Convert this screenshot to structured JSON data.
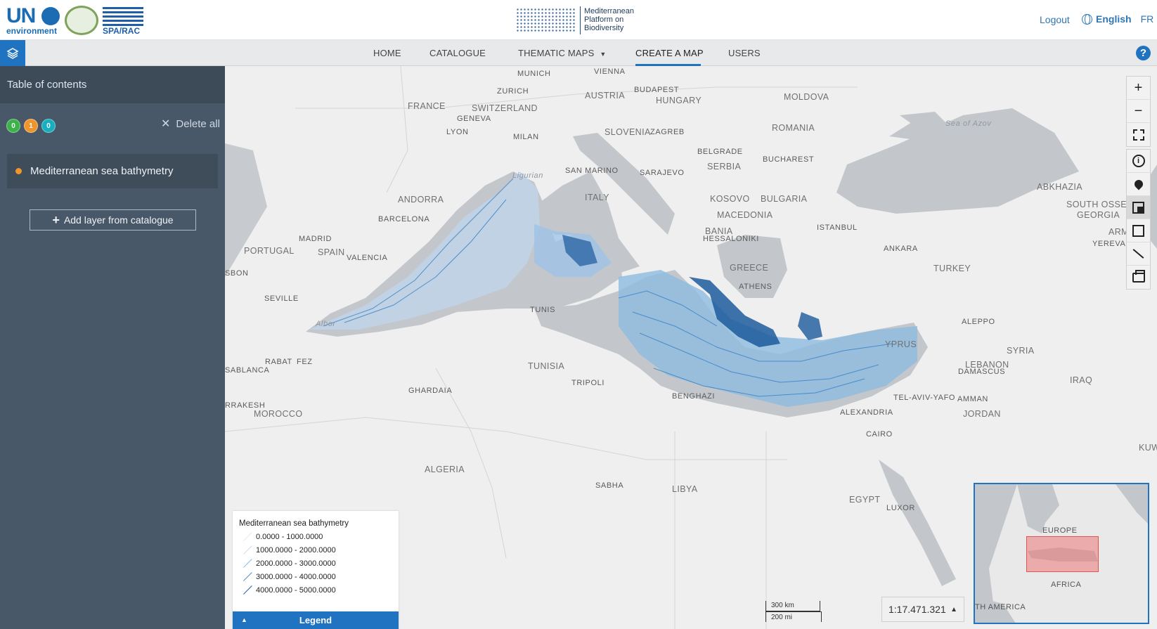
{
  "header": {
    "logo_un": "UN",
    "logo_un_sub": "environment",
    "logo_spa": "SPA/RAC",
    "brand_lines": [
      "Mediterranean",
      "Platform on",
      "Biodiversity"
    ],
    "logout": "Logout",
    "lang_active": "English",
    "lang_other": "FR"
  },
  "nav": {
    "home": "HOME",
    "catalogue": "CATALOGUE",
    "thematic": "THEMATIC MAPS",
    "create": "CREATE A MAP",
    "users": "USERS",
    "help": "?"
  },
  "sidebar": {
    "title": "Table of contents",
    "badges": [
      "0",
      "1",
      "0"
    ],
    "delete_all": "Delete all",
    "layer": "Mediterranean sea bathymetry",
    "add_layer": "Add layer from catalogue"
  },
  "map": {
    "labels": {
      "munich": "MUNICH",
      "vienna": "VIENNA",
      "zurich": "ZURICH",
      "austria": "AUSTRIA",
      "budapest": "BUDAPEST",
      "hungary": "HUNGARY",
      "moldova": "MOLDOVA",
      "france": "FRANCE",
      "switzerland": "SWITZERLAND",
      "geneva": "GENEVA",
      "lyon": "LYON",
      "milan": "MILAN",
      "slovenia": "SLOVENIA",
      "zagreb": "ZAGREB",
      "romania": "ROMANIA",
      "azov": "Sea of Azov",
      "belgrade": "BELGRADE",
      "bucharest": "BUCHAREST",
      "serbia": "SERBIA",
      "sanmarino": "SAN MARINO",
      "sarajevo": "SARAJEVO",
      "andorra": "ANDORRA",
      "italy": "ITALY",
      "kosovo": "KOSOVO",
      "bulgaria": "BULGARIA",
      "abkhazia": "ABKHAZIA",
      "southossetia": "SOUTH OSSETI",
      "georgia": "GEORGIA",
      "barcelona": "BARCELONA",
      "macedonia": "MACEDONIA",
      "istanbul": "ISTANBUL",
      "armenia": "ARMENIA",
      "madrid": "MADRID",
      "portugal": "PORTUGAL",
      "spain": "SPAIN",
      "bania": "BANIA",
      "thessaloniki": "HESSALONIKI",
      "ankara": "ANKARA",
      "yerevan": "YEREVAN",
      "valencia": "VALENCIA",
      "greece": "GREECE",
      "turkey": "TURKEY",
      "lisbon": "SBON",
      "athens": "ATHENS",
      "seville": "SEVILLE",
      "tunis": "TUNIS",
      "aleppo": "ALEPPO",
      "syria": "SYRIA",
      "cyprus": "YPRUS",
      "rabat": "RABAT",
      "fez": "FEZ",
      "casablanca": "SABLANCA",
      "tunisia": "TUNISIA",
      "lebanon": "LEBANON",
      "damascus": "DAMASCUS",
      "iraq": "IRAQ",
      "ghardaia": "GHARDAIA",
      "tripoli": "TRIPOLI",
      "telaviv": "TEL-AVIV-YAFO",
      "amman": "AMMAN",
      "marrakesh": "RRAKESH",
      "morocco": "MOROCCO",
      "benghazi": "BENGHAZI",
      "alexandria": "ALEXANDRIA",
      "jordan": "JORDAN",
      "cairo": "CAIRO",
      "kuw": "KUW",
      "algeria": "ALGERIA",
      "sabha": "SABHA",
      "libya": "LIBYA",
      "egypt": "EGYPT",
      "luxor": "LUXOR",
      "ligurian": "Ligurian",
      "alboran": "Albor"
    },
    "tools": {
      "zoom_in": "+",
      "zoom_out": "−",
      "info": "i"
    },
    "legend": {
      "title": "Mediterranean sea bathymetry",
      "rows": [
        "0.0000 - 1000.0000",
        "1000.0000 - 2000.0000",
        "2000.0000 - 3000.0000",
        "3000.0000 - 4000.0000",
        "4000.0000 - 5000.0000"
      ],
      "row_colors": [
        "#ffffff",
        "#c9dff2",
        "#8dbbe0",
        "#4a8dc7",
        "#1c5a9e"
      ],
      "button": "Legend",
      "caret": "▲"
    },
    "scale": {
      "km": "300 km",
      "mi": "200 mi"
    },
    "scale_select": {
      "value": "1:17.471.321",
      "caret": "▲"
    },
    "overview": {
      "europe": "EUROPE",
      "africa": "AFRICA",
      "america": "TH AMERICA"
    }
  },
  "colors": {
    "primary": "#1f73c0",
    "sidebar": "#495869",
    "water": "#c3c7cb",
    "land": "#efefef",
    "bathy_light": "#bfd7ee",
    "bathy_dark": "#0d3f85"
  }
}
